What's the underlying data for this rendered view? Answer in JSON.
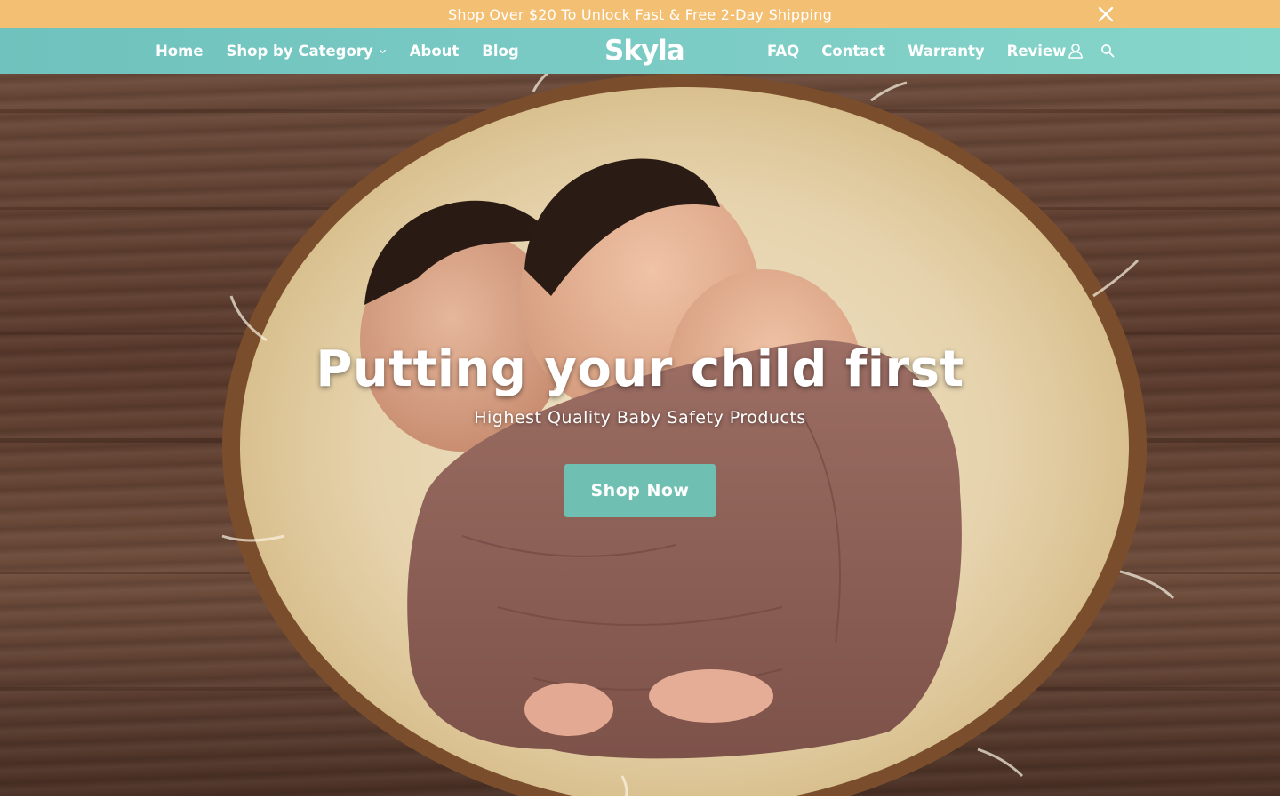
{
  "announcement": {
    "text": "Shop Over $20 To Unlock Fast & Free 2-Day Shipping",
    "close_icon": "close-icon"
  },
  "nav": {
    "left": [
      {
        "label": "Home"
      },
      {
        "label": "Shop by Category",
        "icon": "chevron-down-icon"
      },
      {
        "label": "About"
      },
      {
        "label": "Blog"
      }
    ],
    "logo": "Skyla",
    "right": [
      {
        "label": "FAQ"
      },
      {
        "label": "Contact"
      },
      {
        "label": "Warranty"
      },
      {
        "label": "Review"
      }
    ],
    "icons": [
      "user-icon",
      "search-icon"
    ]
  },
  "hero": {
    "title": "Putting your child first",
    "subtitle": "Highest Quality Baby Safety Products",
    "button_label": "Shop Now",
    "image": "hero-photo-twin-babies-in-basket"
  },
  "colors": {
    "announcement_bg": "#f3bf72",
    "nav_bg": "#7bcbc5",
    "button_bg": "#6fbfb2",
    "text_light": "#ffffff"
  }
}
